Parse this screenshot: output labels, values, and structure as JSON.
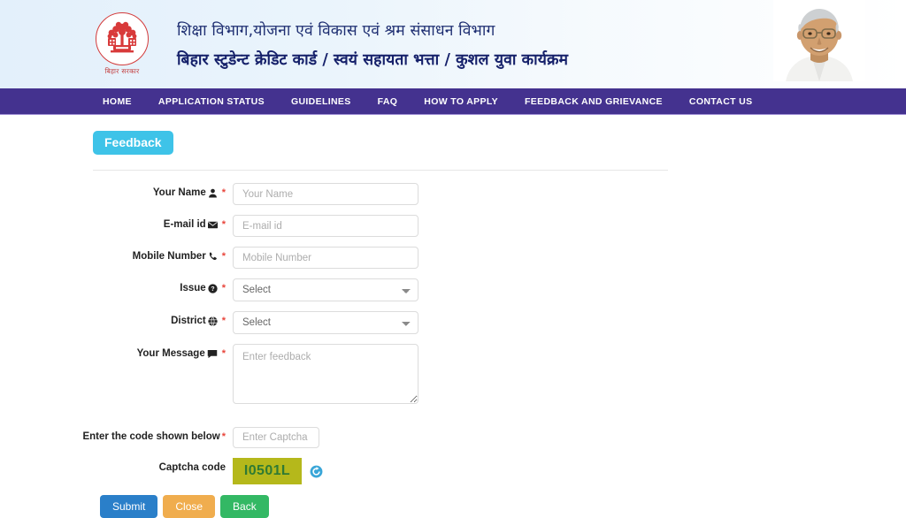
{
  "header": {
    "emblem_caption": "बिहार  सरकार",
    "emblem_icon": "bihar-government-seal",
    "title_line1": "शिक्षा विभाग,योजना एवं विकास एवं श्रम संसाधन विभाग",
    "title_line2": "बिहार स्टुडेन्ट क्रेडिट कार्ड / स्वयं सहायता भत्ता / कुशल युवा कार्यक्रम",
    "portrait_alt": "chief-minister-portrait",
    "background_color": "#e3f0fb"
  },
  "nav": {
    "background_color": "#44328f",
    "items": [
      {
        "label": "HOME"
      },
      {
        "label": "APPLICATION STATUS"
      },
      {
        "label": "GUIDELINES"
      },
      {
        "label": "FAQ"
      },
      {
        "label": "HOW TO APPLY"
      },
      {
        "label": "FEEDBACK AND GRIEVANCE"
      },
      {
        "label": "CONTACT US"
      }
    ]
  },
  "page": {
    "badge": "Feedback",
    "badge_color": "#3ec3e8"
  },
  "form": {
    "fields": [
      {
        "label": "Your Name",
        "icon": "user-icon",
        "required": "*",
        "placeholder": "Your Name",
        "value": "",
        "type": "text"
      },
      {
        "label": "E-mail id",
        "icon": "envelope-icon",
        "required": "*",
        "placeholder": "E-mail id",
        "value": "",
        "type": "text"
      },
      {
        "label": "Mobile Number",
        "icon": "phone-icon",
        "required": "*",
        "placeholder": "Mobile Number",
        "value": "",
        "type": "text"
      },
      {
        "label": "Issue",
        "icon": "question-circle-icon",
        "required": "*",
        "placeholder": "Select",
        "value": "Select",
        "type": "select",
        "options": [
          "Select"
        ]
      },
      {
        "label": "District",
        "icon": "globe-icon",
        "required": "*",
        "placeholder": "Select",
        "value": "Select",
        "type": "select",
        "options": [
          "Select"
        ]
      },
      {
        "label": "Your Message",
        "icon": "comment-icon",
        "required": "*",
        "placeholder": "Enter feedback",
        "value": "",
        "type": "textarea"
      }
    ],
    "captcha_entry": {
      "label": "Enter the code shown below",
      "required": "*",
      "placeholder": "Enter Captcha",
      "value": ""
    },
    "captcha_display": {
      "label": "Captcha code",
      "code": "I0501L",
      "background_color": "#b5b81b",
      "text_color": "#2f7a33",
      "refresh_icon": "refresh-icon"
    },
    "buttons": [
      {
        "label": "Submit",
        "color": "#2a7fc9"
      },
      {
        "label": "Close",
        "color": "#f0ad4e"
      },
      {
        "label": "Back",
        "color": "#33b864"
      }
    ]
  }
}
